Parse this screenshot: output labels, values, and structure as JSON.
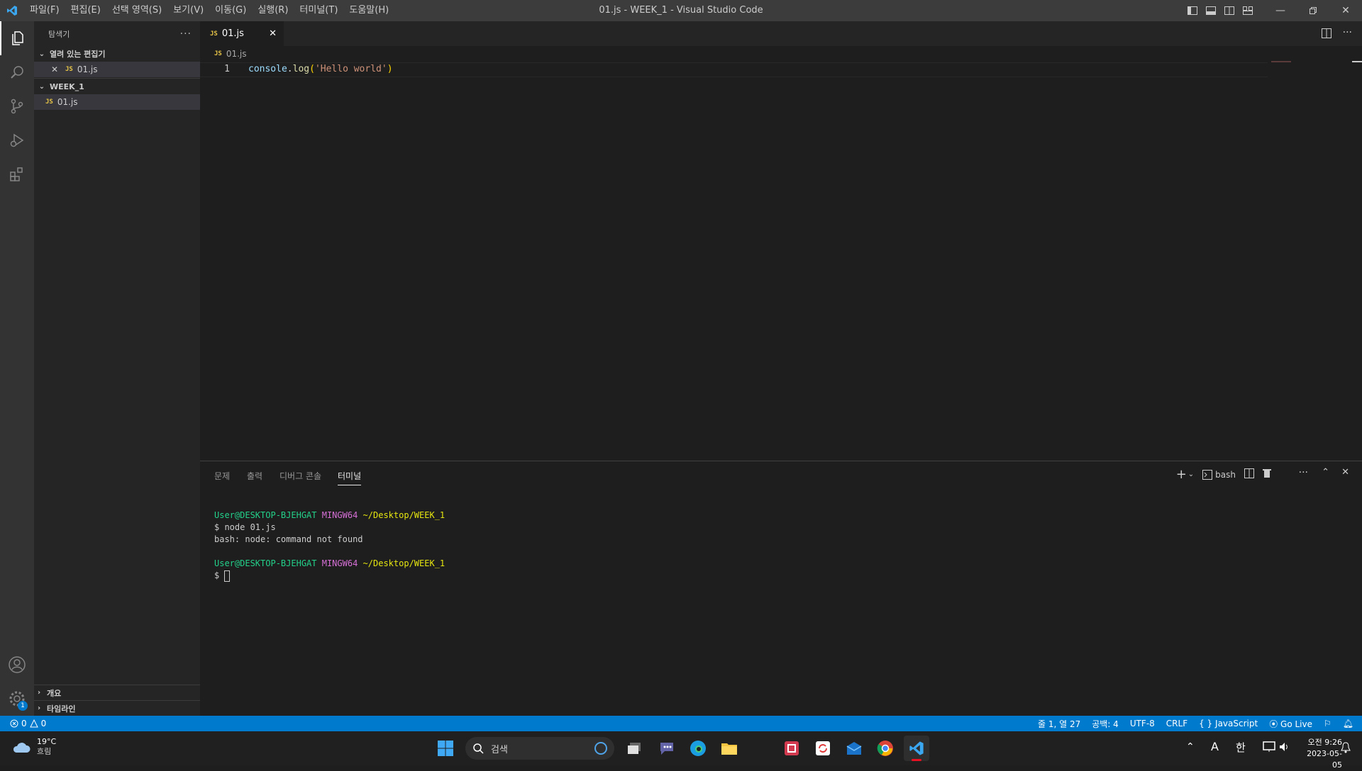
{
  "titlebar": {
    "menu": [
      "파일(F)",
      "편집(E)",
      "선택 영역(S)",
      "보기(V)",
      "이동(G)",
      "실행(R)",
      "터미널(T)",
      "도움말(H)"
    ],
    "window_title": "01.js - WEEK_1 - Visual Studio Code"
  },
  "sidebar": {
    "title": "탐색기",
    "open_editors": {
      "label": "열려 있는 편집기",
      "items": [
        {
          "badge": "JS",
          "name": "01.js"
        }
      ]
    },
    "folder": {
      "label": "WEEK_1",
      "items": [
        {
          "badge": "JS",
          "name": "01.js"
        }
      ]
    },
    "outline_label": "개요",
    "timeline_label": "타임라인"
  },
  "editor": {
    "tab": {
      "badge": "JS",
      "name": "01.js"
    },
    "breadcrumb": {
      "badge": "JS",
      "name": "01.js"
    },
    "line_number": "1",
    "code": {
      "object": "console",
      "dot": ".",
      "method": "log",
      "open": "(",
      "string": "'Hello world'",
      "close": ")"
    }
  },
  "panel": {
    "tabs": [
      "문제",
      "출력",
      "디버그 콘솔",
      "터미널"
    ],
    "active_tab_index": 3,
    "shell_label": "bash",
    "terminal": {
      "user": "User@DESKTOP-BJEHGAT",
      "host": "MINGW64",
      "path": "~/Desktop/WEEK_1",
      "command": "$ node 01.js",
      "error": "bash: node: command not found",
      "prompt": "$ "
    }
  },
  "activity": {
    "settings_badge": "1"
  },
  "statusbar": {
    "errors": "0",
    "warnings": "0",
    "position": "줄 1, 열 27",
    "spaces": "공백: 4",
    "encoding": "UTF-8",
    "eol": "CRLF",
    "language": "JavaScript",
    "golive": "Go Live"
  },
  "taskbar": {
    "temperature": "19°C",
    "weather": "흐림",
    "search_placeholder": "검색",
    "ime_a": "A",
    "ime_han": "한",
    "time": "오전 9:26",
    "date": "2023-05-05"
  },
  "colors": {
    "accent": "#007acc",
    "js_badge": "#e8c547",
    "term_user": "#23d18b",
    "term_host": "#d670d6",
    "term_path": "#e5e510"
  }
}
